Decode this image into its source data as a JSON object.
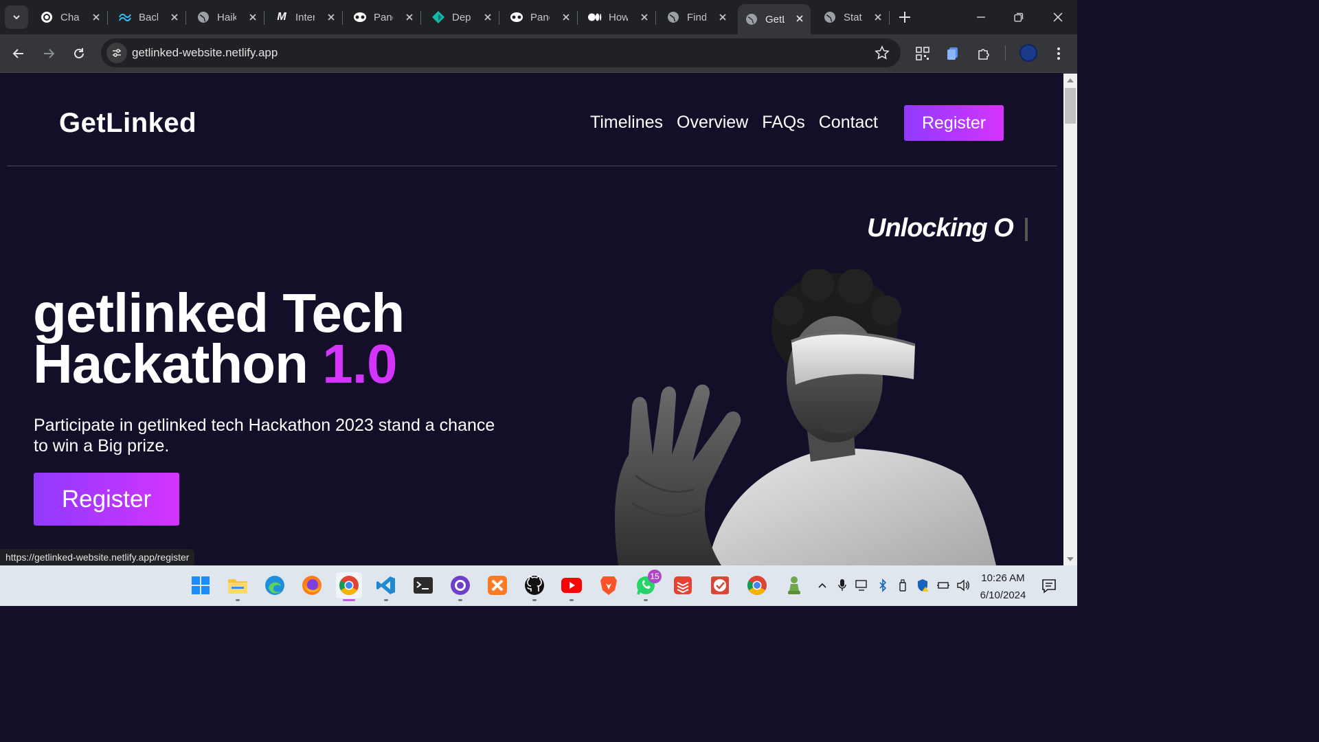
{
  "browser": {
    "tabs": [
      {
        "title": "ChatGPT",
        "icon": "openai-icon"
      },
      {
        "title": "Backgrounds",
        "icon": "tailwind-icon"
      },
      {
        "title": "Haiku",
        "icon": "globe-icon"
      },
      {
        "title": "Interview",
        "icon": "m-logo-icon"
      },
      {
        "title": "Panda",
        "icon": "panda-icon"
      },
      {
        "title": "Deploy",
        "icon": "deploy-icon"
      },
      {
        "title": "Panda",
        "icon": "panda-icon"
      },
      {
        "title": "How",
        "icon": "medium-icon"
      },
      {
        "title": "Find",
        "icon": "globe-icon"
      },
      {
        "title": "GetLinked",
        "icon": "globe-icon",
        "active": true
      },
      {
        "title": "Stat",
        "icon": "globe-icon"
      }
    ],
    "url": "getlinked-website.netlify.app",
    "status_url": "https://getlinked-website.netlify.app/register"
  },
  "site": {
    "logo": "GetLinked",
    "nav": [
      "Timelines",
      "Overview",
      "FAQs",
      "Contact"
    ],
    "register_label": "Register",
    "tagline": "Unlocking O",
    "hero": {
      "title_line1": "getlinked Tech",
      "title_line2": "Hackathon",
      "version": "1.0",
      "subtitle": "Participate in getlinked tech Hackathon 2023 stand a chance to win a Big prize.",
      "cta": "Register"
    },
    "colors": {
      "background": "#150e28",
      "accent_start": "#903aff",
      "accent_end": "#d434fe"
    }
  },
  "taskbar": {
    "apps": [
      "start-icon",
      "file-explorer-icon",
      "edge-icon",
      "firefox-icon",
      "chrome-icon",
      "vscode-icon",
      "terminal-icon",
      "github-desktop-icon",
      "xampp-icon",
      "github-icon",
      "youtube-icon",
      "brave-icon",
      "whatsapp-icon",
      "todoist-icon",
      "tick-app-icon",
      "chrome-icon",
      "chess-icon"
    ],
    "whatsapp_badge": "15",
    "time": "10:26 AM",
    "date": "6/10/2024"
  }
}
